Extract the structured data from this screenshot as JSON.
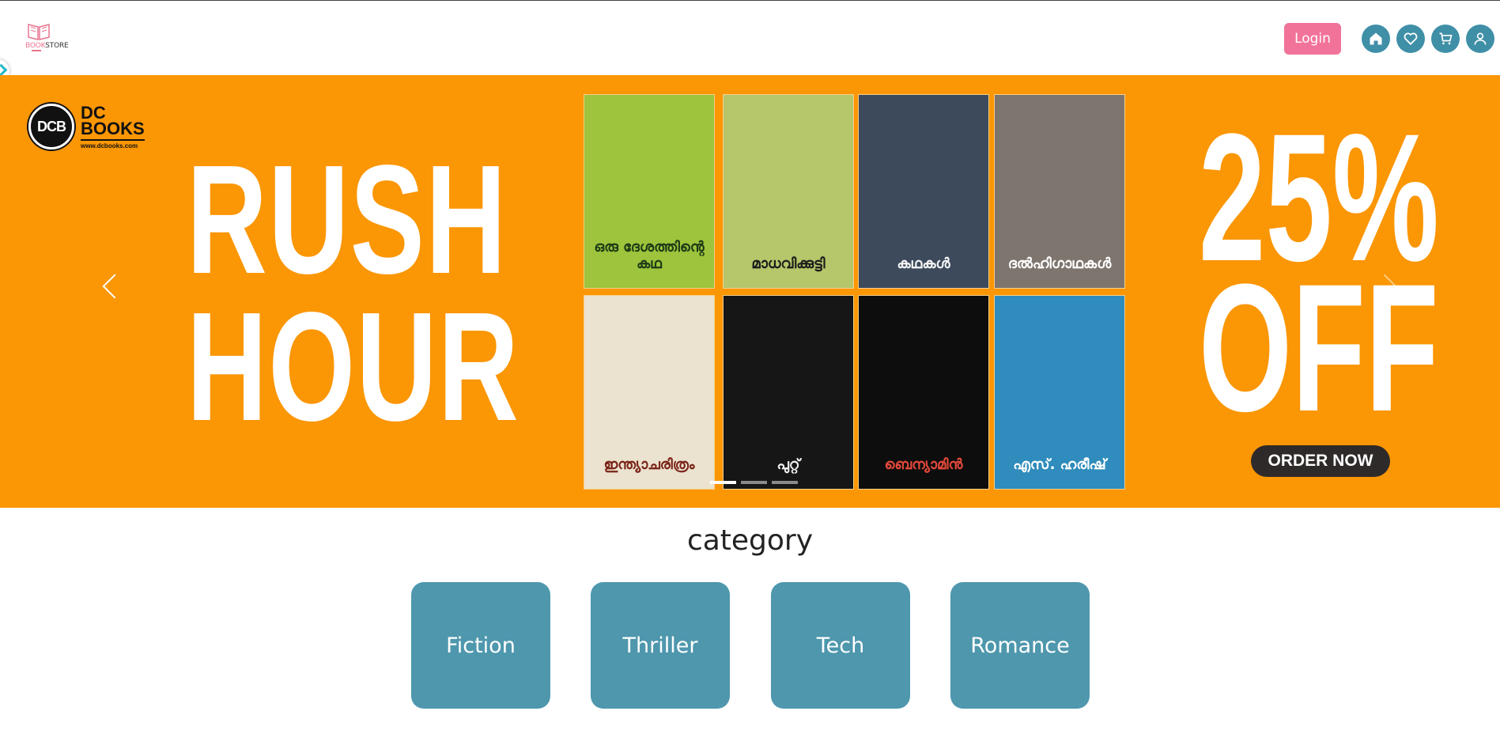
{
  "header": {
    "logo_text_pre": "BOOK",
    "logo_text_post": "STORE",
    "login_label": "Login",
    "icons": [
      "home-icon",
      "heart-icon",
      "cart-icon",
      "user-icon"
    ],
    "icon_color": "#3f8fa7",
    "login_color": "#f2739a"
  },
  "banner": {
    "bg_color": "#fb9604",
    "publisher_badge": "DCB",
    "publisher_name_1": "DC",
    "publisher_name_2": "BOOKS",
    "publisher_url": "www.dcbooks.com",
    "headline_1": "RUSH",
    "headline_2": "HOUR",
    "discount_1": "25%",
    "discount_2": "OFF",
    "cta": "ORDER NOW",
    "books": [
      {
        "title": "ഒരു ദേശത്തിന്റെ കഥ",
        "bg": "#9dc43c",
        "fg": "#1d3b16"
      },
      {
        "title": "മാധവിക്കുട്ടി",
        "bg": "#b5c66b",
        "fg": "#1b1b1b"
      },
      {
        "title": "കഥകൾ",
        "bg": "#3c4a5c",
        "fg": "#f4f4f4"
      },
      {
        "title": "ദൽഹിഗാഥകൾ",
        "bg": "#7e766e",
        "fg": "#ffffff"
      },
      {
        "title": "ഇന്ത്യാചരിത്രം",
        "bg": "#ebe2cf",
        "fg": "#7a2418"
      },
      {
        "title": "പുറ്റ്",
        "bg": "#161616",
        "fg": "#f0f0f0"
      },
      {
        "title": "ബെന്യാമിൻ",
        "bg": "#0d0d0d",
        "fg": "#e2483a"
      },
      {
        "title": "എസ്. ഹരീഷ്",
        "bg": "#2f8cbc",
        "fg": "#ffffff"
      }
    ],
    "slide_count": 3,
    "active_slide": 0
  },
  "category": {
    "title": "category",
    "items": [
      "Fiction",
      "Thriller",
      "Tech",
      "Romance"
    ],
    "card_color": "#4e97ad"
  }
}
